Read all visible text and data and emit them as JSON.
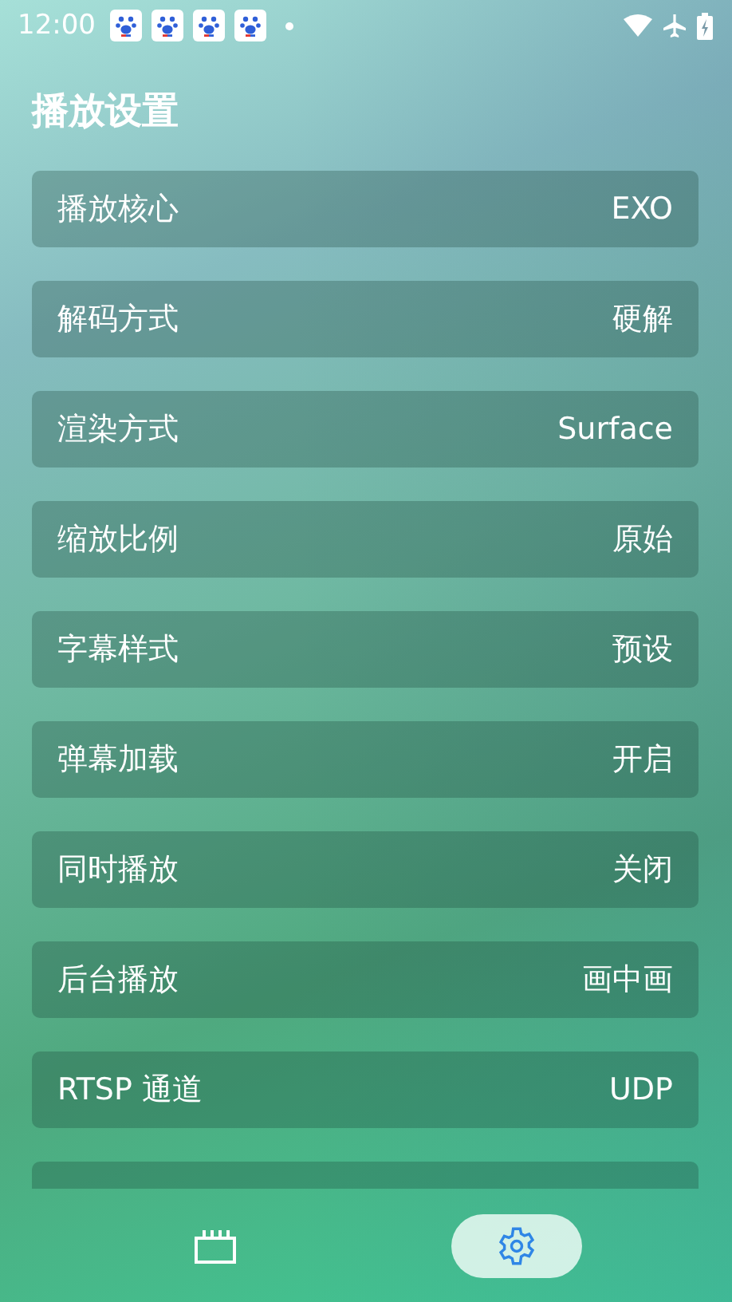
{
  "status_bar": {
    "time": "12:00",
    "notifications": [
      {
        "kind": "app"
      },
      {
        "kind": "app"
      },
      {
        "kind": "app"
      },
      {
        "kind": "app"
      }
    ]
  },
  "title": "播放设置",
  "settings": [
    {
      "label": "播放核心",
      "value": "EXO"
    },
    {
      "label": "解码方式",
      "value": "硬解"
    },
    {
      "label": "渲染方式",
      "value": "Surface"
    },
    {
      "label": "缩放比例",
      "value": "原始"
    },
    {
      "label": "字幕样式",
      "value": "预设"
    },
    {
      "label": "弹幕加载",
      "value": "开启"
    },
    {
      "label": "同时播放",
      "value": "关闭"
    },
    {
      "label": "后台播放",
      "value": "画中画"
    },
    {
      "label": "RTSP 通道",
      "value": "UDP"
    }
  ],
  "bottom_nav": [
    {
      "kind": "movies",
      "selected": false
    },
    {
      "kind": "settings",
      "selected": true
    }
  ]
}
